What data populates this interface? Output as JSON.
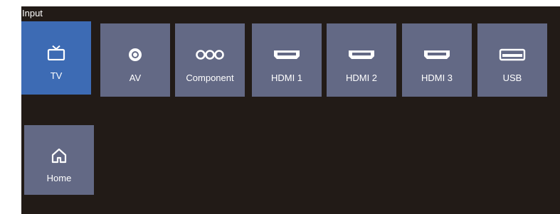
{
  "header": {
    "title": "Input"
  },
  "sources": [
    {
      "label": "TV",
      "icon": "tv-icon",
      "selected": true
    },
    {
      "label": "AV",
      "icon": "av-jack-icon",
      "selected": false
    },
    {
      "label": "Component",
      "icon": "component-icon",
      "selected": false
    },
    {
      "label": "HDMI 1",
      "icon": "hdmi-icon",
      "selected": false
    },
    {
      "label": "HDMI 2",
      "icon": "hdmi-icon",
      "selected": false
    },
    {
      "label": "HDMI 3",
      "icon": "hdmi-icon",
      "selected": false
    },
    {
      "label": "USB",
      "icon": "usb-icon",
      "selected": false
    }
  ],
  "home": {
    "label": "Home",
    "icon": "home-icon"
  },
  "colors": {
    "background": "#221b17",
    "tile": "#636985",
    "selected_tile": "#3d6bb4",
    "text": "#ffffff"
  }
}
